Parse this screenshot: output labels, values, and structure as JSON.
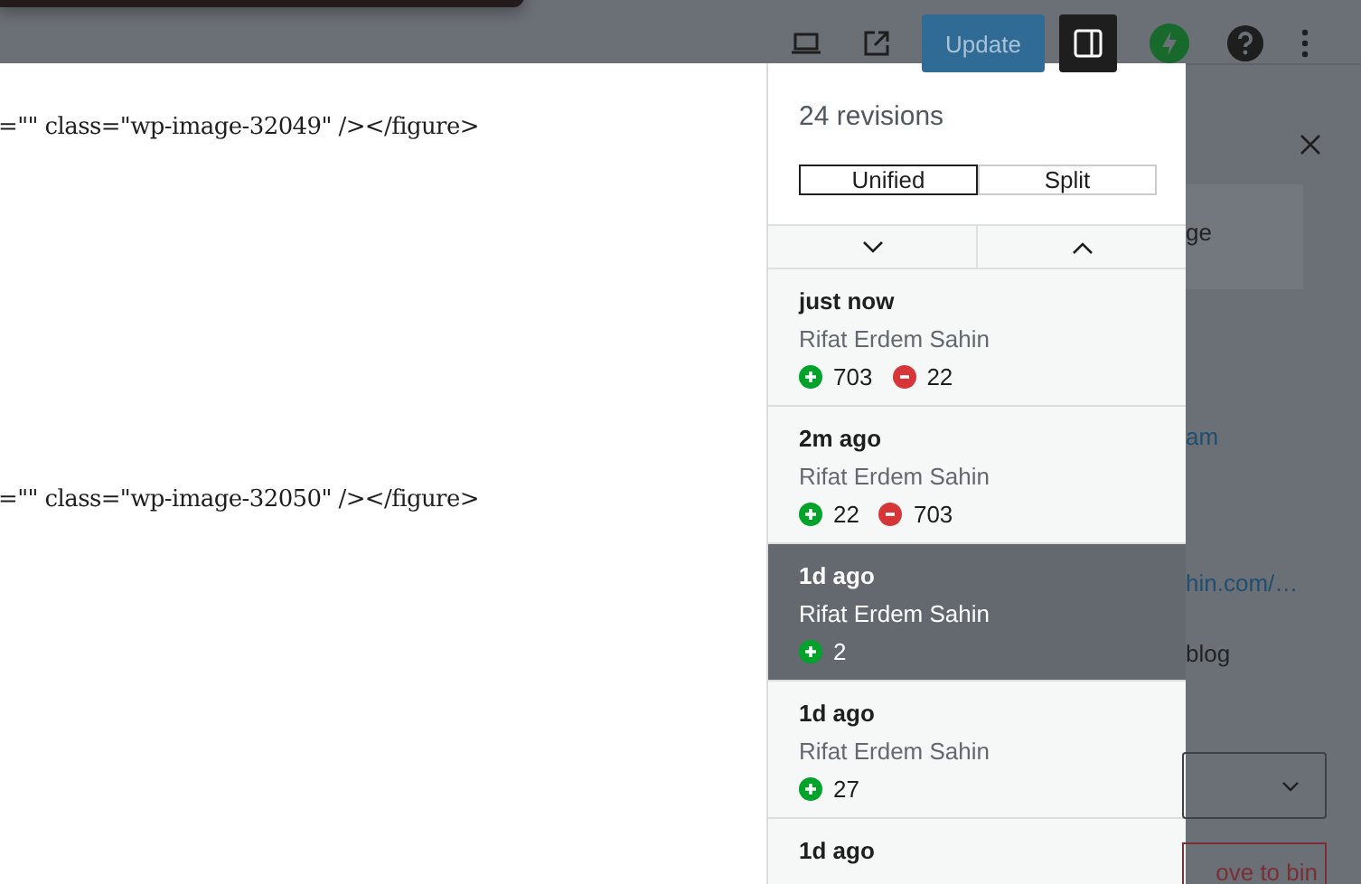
{
  "toolbar": {
    "update_button": "Update",
    "sidebar_toggle": {
      "on": true
    }
  },
  "editor": {
    "lines": [
      "=\"\" class=\"wp-image-32049\" /></figure>",
      "=\"\" class=\"wp-image-32050\" /></figure>"
    ]
  },
  "revisions_panel": {
    "title": "24 revisions",
    "view_toggle": [
      {
        "label": "Unified",
        "selected": true
      },
      {
        "label": "Split",
        "selected": false
      }
    ],
    "revisions": [
      {
        "time": "just now",
        "author": "Rifat Erdem Sahin",
        "added": "703",
        "removed": "22",
        "selected": false
      },
      {
        "time": "2m ago",
        "author": "Rifat Erdem Sahin",
        "added": "22",
        "removed": "703",
        "selected": false
      },
      {
        "time": "1d ago",
        "author": "Rifat Erdem Sahin",
        "added": "2",
        "selected": true
      },
      {
        "time": "1d ago",
        "author": "Rifat Erdem Sahin",
        "added": "27",
        "selected": false
      },
      {
        "time": "1d ago",
        "selected": false
      }
    ]
  },
  "sidebar": {
    "box_text": "ge",
    "link_1": "am",
    "link_2": "hin.com/…",
    "label": "blog",
    "bin_button": "ove to bin"
  }
}
